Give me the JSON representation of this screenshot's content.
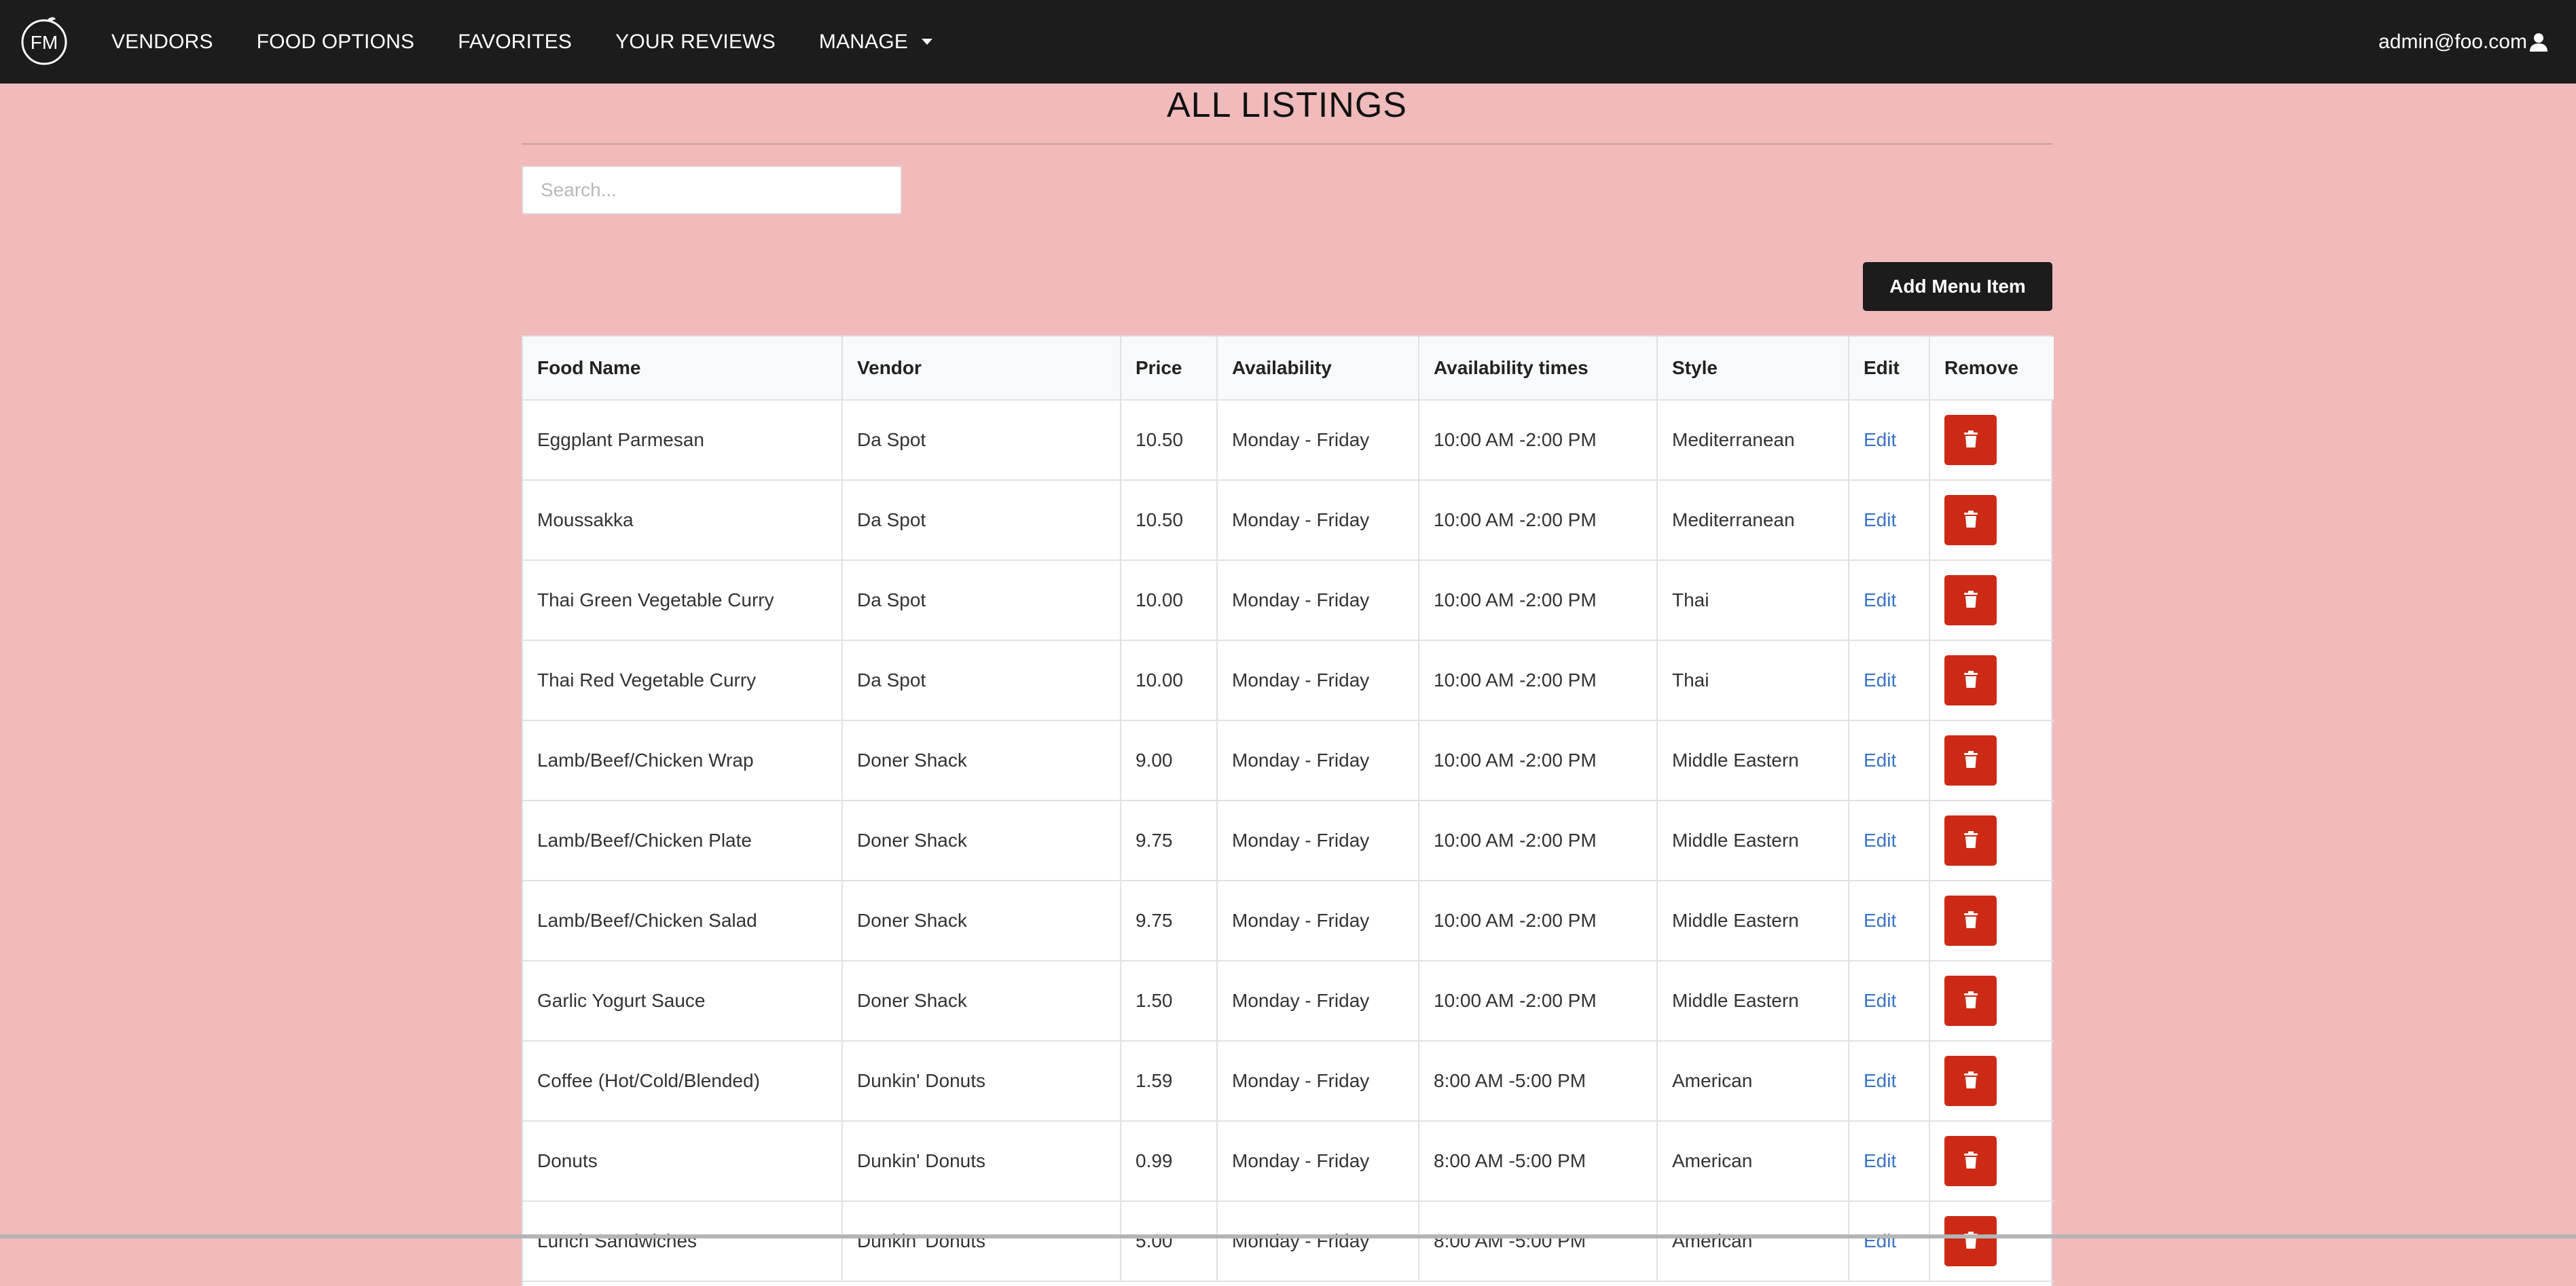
{
  "nav": {
    "logo_text": "FM",
    "items": [
      "VENDORS",
      "FOOD OPTIONS",
      "FAVORITES",
      "YOUR REVIEWS",
      "MANAGE"
    ],
    "user_email": "admin@foo.com"
  },
  "page": {
    "title": "ALL LISTINGS",
    "search_placeholder": "Search...",
    "add_button_label": "Add Menu Item"
  },
  "table": {
    "headers": [
      "Food Name",
      "Vendor",
      "Price",
      "Availability",
      "Availability times",
      "Style",
      "Edit",
      "Remove"
    ],
    "edit_label": "Edit",
    "rows": [
      [
        "Eggplant Parmesan",
        "Da Spot",
        "10.50",
        "Monday - Friday",
        "10:00 AM -2:00 PM",
        "Mediterranean"
      ],
      [
        "Moussakka",
        "Da Spot",
        "10.50",
        "Monday - Friday",
        "10:00 AM -2:00 PM",
        "Mediterranean"
      ],
      [
        "Thai Green Vegetable Curry",
        "Da Spot",
        "10.00",
        "Monday - Friday",
        "10:00 AM -2:00 PM",
        "Thai"
      ],
      [
        "Thai Red Vegetable Curry",
        "Da Spot",
        "10.00",
        "Monday - Friday",
        "10:00 AM -2:00 PM",
        "Thai"
      ],
      [
        "Lamb/Beef/Chicken Wrap",
        "Doner Shack",
        "9.00",
        "Monday - Friday",
        "10:00 AM -2:00 PM",
        "Middle Eastern"
      ],
      [
        "Lamb/Beef/Chicken Plate",
        "Doner Shack",
        "9.75",
        "Monday - Friday",
        "10:00 AM -2:00 PM",
        "Middle Eastern"
      ],
      [
        "Lamb/Beef/Chicken Salad",
        "Doner Shack",
        "9.75",
        "Monday - Friday",
        "10:00 AM -2:00 PM",
        "Middle Eastern"
      ],
      [
        "Garlic Yogurt Sauce",
        "Doner Shack",
        "1.50",
        "Monday - Friday",
        "10:00 AM -2:00 PM",
        "Middle Eastern"
      ],
      [
        "Coffee (Hot/Cold/Blended)",
        "Dunkin' Donuts",
        "1.59",
        "Monday - Friday",
        "8:00 AM -5:00 PM",
        "American"
      ],
      [
        "Donuts",
        "Dunkin' Donuts",
        "0.99",
        "Monday - Friday",
        "8:00 AM -5:00 PM",
        "American"
      ],
      [
        "Lunch Sandwiches",
        "Dunkin' Donuts",
        "5.00",
        "Monday - Friday",
        "8:00 AM -5:00 PM",
        "American"
      ]
    ]
  },
  "colors": {
    "background": "#f1babb",
    "navbar": "#1c1c1d",
    "delete": "#cc2a14",
    "link": "#3a73c6"
  },
  "icons": [
    "logo-icon",
    "caret-down-icon",
    "user-icon",
    "trash-icon"
  ]
}
